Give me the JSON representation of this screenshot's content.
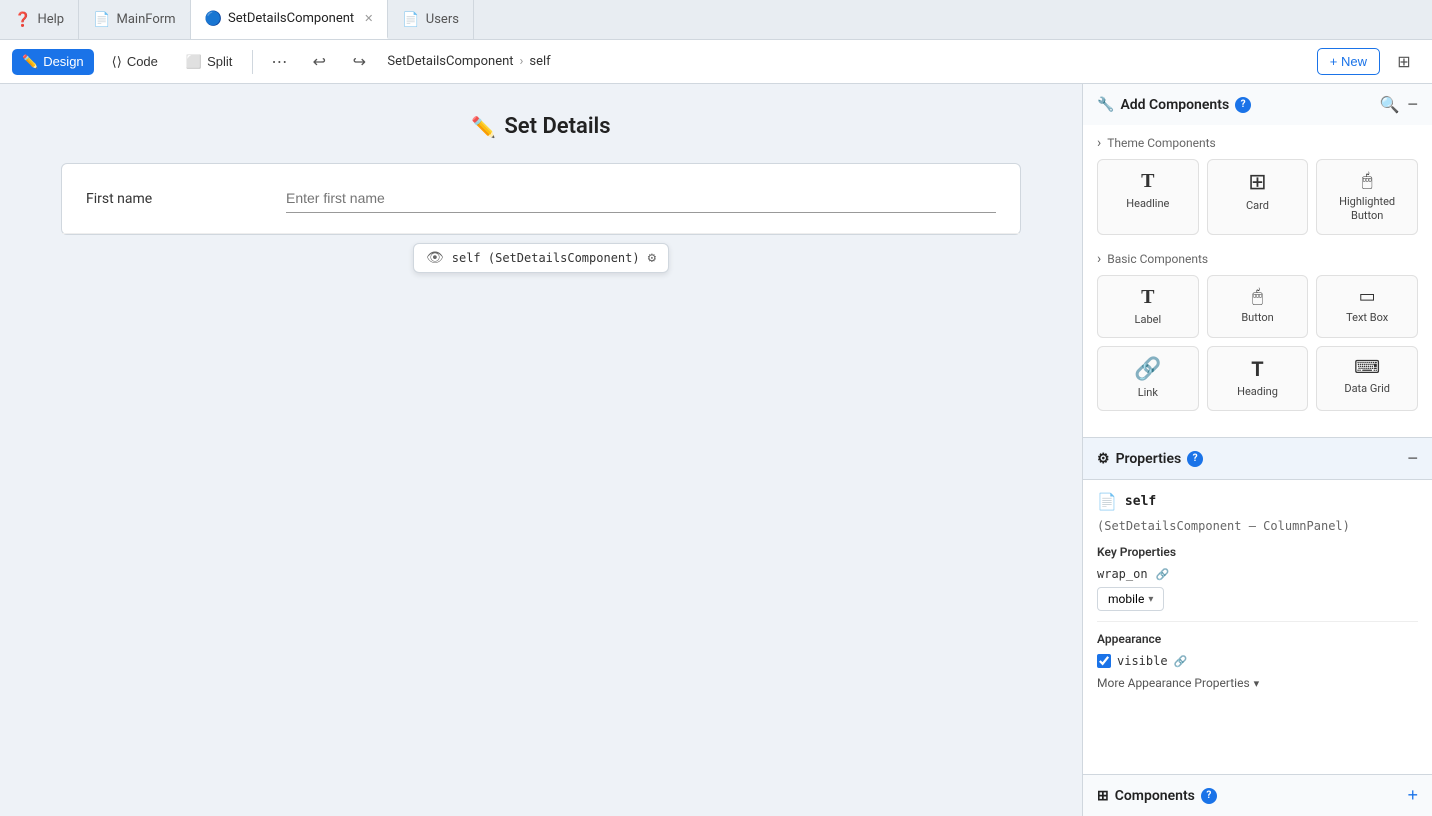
{
  "tabs": [
    {
      "id": "help",
      "label": "Help",
      "icon": "❓",
      "active": false,
      "closable": false
    },
    {
      "id": "mainform",
      "label": "MainForm",
      "icon": "📄",
      "active": false,
      "closable": false
    },
    {
      "id": "setdetails",
      "label": "SetDetailsComponent",
      "icon": "🔵",
      "active": true,
      "closable": true
    },
    {
      "id": "users",
      "label": "Users",
      "icon": "📄",
      "active": false,
      "closable": false
    }
  ],
  "toolbar": {
    "design_label": "Design",
    "code_label": "Code",
    "split_label": "Split",
    "breadcrumb_component": "SetDetailsComponent",
    "breadcrumb_sep": "›",
    "breadcrumb_self": "self",
    "new_label": "+ New"
  },
  "canvas": {
    "title": "Set Details",
    "form_label": "First name",
    "form_placeholder": "Enter first name",
    "tooltip_text": "self (SetDetailsComponent)",
    "tooltip_settings": "⚙"
  },
  "add_components": {
    "title": "Add Components",
    "theme_section": "Theme Components",
    "basic_section": "Basic Components",
    "components": [
      {
        "id": "headline",
        "label": "Headline",
        "icon": "T̲"
      },
      {
        "id": "card",
        "label": "Card",
        "icon": "⊞"
      },
      {
        "id": "highlighted-button",
        "label": "Highlighted Button",
        "icon": "🖱"
      },
      {
        "id": "label",
        "label": "Label",
        "icon": "T̲"
      },
      {
        "id": "button",
        "label": "Button",
        "icon": "🖱"
      },
      {
        "id": "text-box",
        "label": "Text Box",
        "icon": "▭"
      },
      {
        "id": "link",
        "label": "Link",
        "icon": "🔗"
      },
      {
        "id": "heading",
        "label": "Heading",
        "icon": "T̲"
      },
      {
        "id": "data-grid",
        "label": "Data Grid",
        "icon": "⌨"
      }
    ]
  },
  "properties": {
    "title": "Properties",
    "self_name": "self",
    "self_type": "(SetDetailsComponent – ColumnPanel)",
    "key_properties_title": "Key Properties",
    "wrap_on_key": "wrap_on",
    "wrap_on_value": "mobile",
    "appearance_title": "Appearance",
    "visible_key": "visible",
    "more_appearance_label": "More Appearance Properties"
  },
  "components_footer": {
    "title": "Components",
    "add_tooltip": "Add component"
  },
  "colors": {
    "accent": "#1a73e8",
    "active_tab_bg": "#ffffff",
    "panel_bg": "#f8fafc"
  }
}
